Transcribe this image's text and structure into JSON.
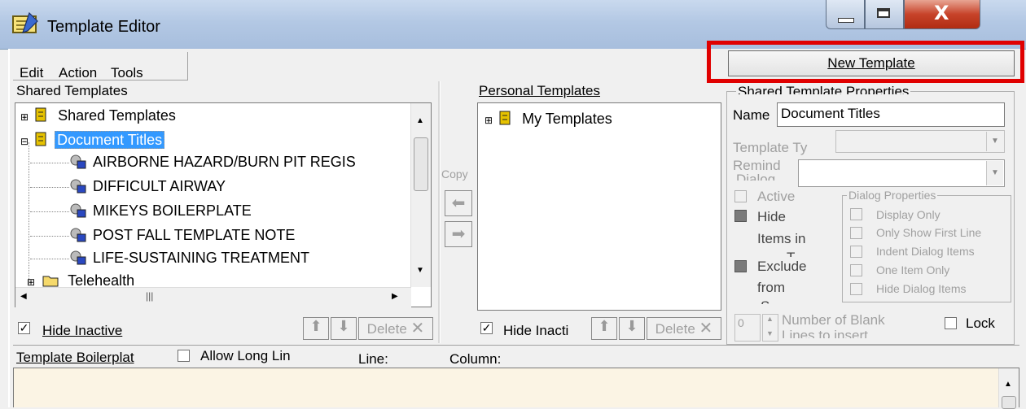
{
  "window": {
    "title": "Template Editor"
  },
  "menu": {
    "items": [
      "Edit",
      "Action",
      "Tools"
    ]
  },
  "shared": {
    "header": "Shared Templates",
    "tree": [
      {
        "expander": "⊞",
        "label": "Shared Templates",
        "type": "folder"
      },
      {
        "expander": "⊟",
        "label": "Document Titles",
        "type": "folder",
        "selected": true
      },
      {
        "label": "AIRBORNE HAZARD/BURN PIT REGIS",
        "type": "template"
      },
      {
        "label": "DIFFICULT AIRWAY",
        "type": "template"
      },
      {
        "label": "MIKEYS BOILERPLATE",
        "type": "template"
      },
      {
        "label": "POST FALL TEMPLATE NOTE",
        "type": "template"
      },
      {
        "label": "LIFE-SUSTAINING TREATMENT",
        "type": "template"
      },
      {
        "expander": "⊞",
        "label": "Telehealth",
        "type": "folder"
      }
    ],
    "hide_inactive": "Hide Inactive",
    "delete": "Delete"
  },
  "copy": {
    "label": "Copy"
  },
  "personal": {
    "header": "Personal Templates",
    "tree": [
      {
        "expander": "⊞",
        "label": "My Templates"
      }
    ],
    "hide_inactive": "Hide Inacti",
    "delete": "Delete"
  },
  "new_template_button": "New Template",
  "props": {
    "title": "Shared Template Properties",
    "name_label": "Name",
    "name_value": "Document Titles",
    "template_type_label": "Template Ty",
    "reminder_label": "Remind",
    "dialog_label": "Dialog",
    "active_label": "Active",
    "hide_items_label": "Hide",
    "hide_items_label2": "Items in",
    "hide_items_label3": "T",
    "exclude_label": "Exclude",
    "exclude_label2": "from",
    "exclude_label3": "S",
    "dialog_props_title": "Dialog Properties",
    "dialog_props": [
      "Display Only",
      "Only Show First Line",
      "Indent Dialog Items",
      "One Item Only",
      "Hide Dialog Items"
    ],
    "blank_lines_value": "0",
    "blank_lines_label": "Number of Blank",
    "blank_lines_label2": "Lines to insert",
    "lock_label": "Lock"
  },
  "boilerplate": {
    "label": "Template Boilerplat",
    "allow_long": "Allow Long Lin",
    "line_label": "Line:",
    "column_label": "Column:"
  },
  "colors": {
    "selection": "#3399ff",
    "highlight_box": "#e00000",
    "editor_bg": "#fbf4e4"
  }
}
